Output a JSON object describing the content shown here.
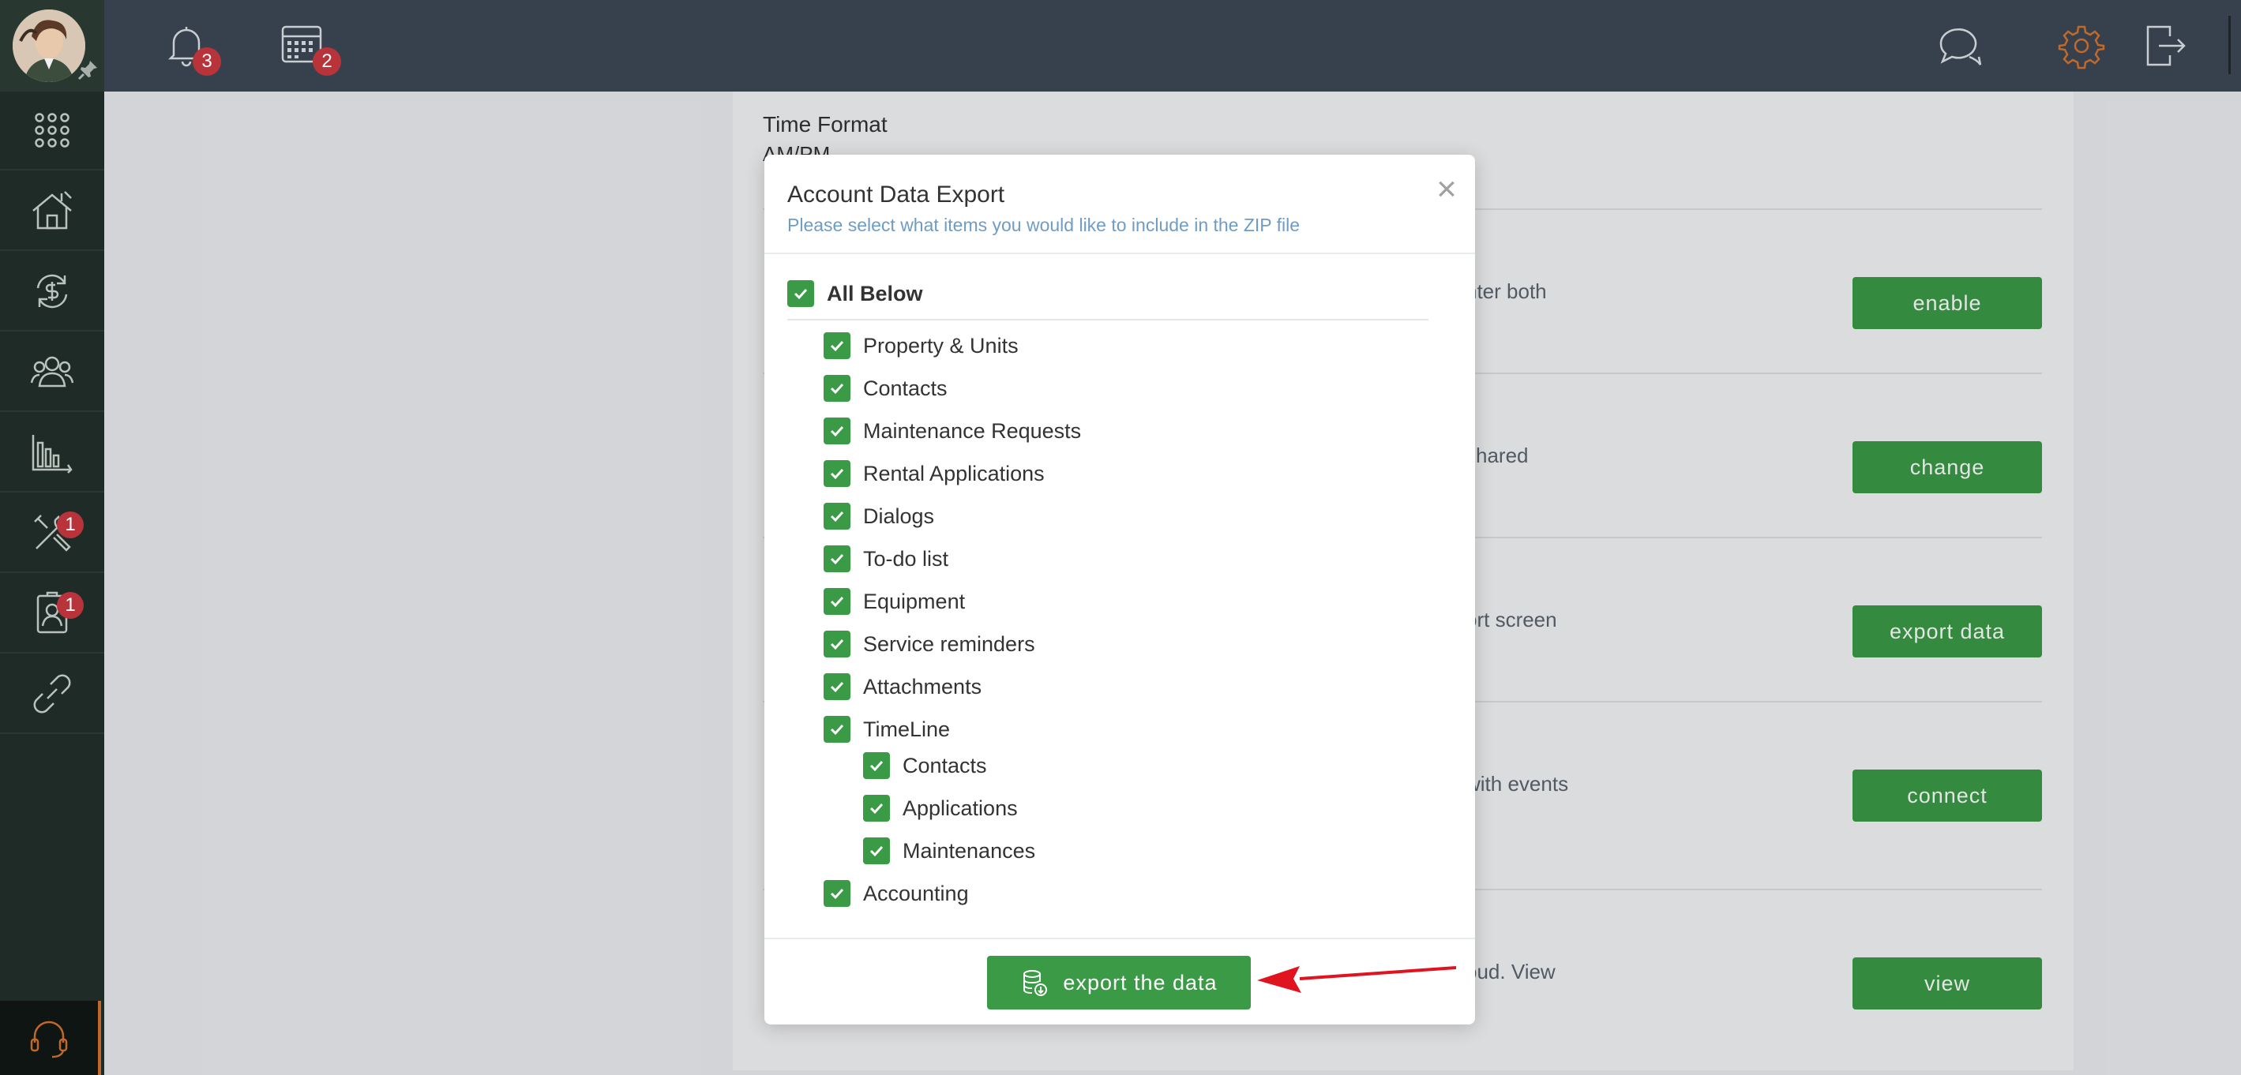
{
  "topbar": {
    "notifications_count": "3",
    "calendar_count": "2"
  },
  "sidebar": {
    "tools_badge": "1",
    "contacts_badge": "1"
  },
  "background": {
    "time_format_label": "Time Format",
    "time_format_value": "AM/PM",
    "rows": [
      {
        "text": "nter both",
        "button": "enable"
      },
      {
        "text": "shared",
        "button": "change"
      },
      {
        "text": "ort screen",
        "button": "export data"
      },
      {
        "text": "with events",
        "button": "connect"
      },
      {
        "text": "oud. View",
        "button": "view"
      }
    ]
  },
  "modal": {
    "title": "Account Data Export",
    "subtitle": "Please select what items you would like to include in the ZIP file",
    "close": "×",
    "all_label": "All Below",
    "items": [
      {
        "label": "Property & Units",
        "checked": true
      },
      {
        "label": "Contacts",
        "checked": true
      },
      {
        "label": "Maintenance Requests",
        "checked": true
      },
      {
        "label": "Rental Applications",
        "checked": true
      },
      {
        "label": "Dialogs",
        "checked": true
      },
      {
        "label": "To-do list",
        "checked": true
      },
      {
        "label": "Equipment",
        "checked": true
      },
      {
        "label": "Service reminders",
        "checked": true
      },
      {
        "label": "Attachments",
        "checked": true
      },
      {
        "label": "TimeLine",
        "checked": true
      }
    ],
    "timeline_items": [
      {
        "label": "Contacts",
        "checked": true
      },
      {
        "label": "Applications",
        "checked": true
      },
      {
        "label": "Maintenances",
        "checked": true
      }
    ],
    "accounting_label": "Accounting",
    "export_button": "export the data"
  },
  "colors": {
    "accent_green": "#3a9a46",
    "badge_red": "#b8343a",
    "topbar": "#37414d",
    "sidebar": "#1f2b27",
    "arrow_red": "#e0141e"
  }
}
